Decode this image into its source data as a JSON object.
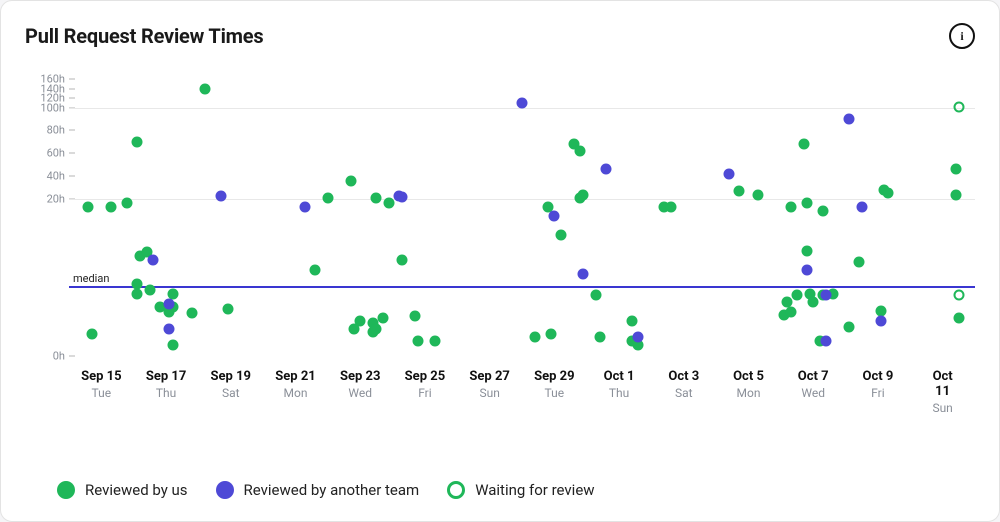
{
  "header": {
    "title": "Pull Request Review Times",
    "info_tooltip": "i"
  },
  "legend": {
    "items": [
      {
        "key": "us",
        "label": "Reviewed by us"
      },
      {
        "key": "other",
        "label": "Reviewed by another team"
      },
      {
        "key": "waiting",
        "label": "Waiting for review"
      }
    ]
  },
  "colors": {
    "us": "#1fb759",
    "other": "#4e49d6",
    "median": "#3a36d1"
  },
  "chart_data": {
    "type": "scatter",
    "title": "Pull Request Review Times",
    "xlabel": "",
    "ylabel": "",
    "y_scale": "log-linear-hybrid",
    "y_ticks": [
      0,
      20,
      40,
      60,
      80,
      100,
      120,
      140,
      160
    ],
    "y_tick_labels": [
      "0h",
      "20h",
      "40h",
      "60h",
      "80h",
      "100h",
      "120h",
      "140h",
      "160h"
    ],
    "y_gridlines": [
      20,
      100
    ],
    "x_ticks": [
      {
        "date": "Sep 15",
        "dow": "Tue"
      },
      {
        "date": "Sep 17",
        "dow": "Thu"
      },
      {
        "date": "Sep 19",
        "dow": "Sat"
      },
      {
        "date": "Sep 21",
        "dow": "Mon"
      },
      {
        "date": "Sep 23",
        "dow": "Wed"
      },
      {
        "date": "Sep 25",
        "dow": "Fri"
      },
      {
        "date": "Sep 27",
        "dow": "Sun"
      },
      {
        "date": "Sep 29",
        "dow": "Tue"
      },
      {
        "date": "Oct 1",
        "dow": "Thu"
      },
      {
        "date": "Oct 3",
        "dow": "Sat"
      },
      {
        "date": "Oct 5",
        "dow": "Mon"
      },
      {
        "date": "Oct 7",
        "dow": "Wed"
      },
      {
        "date": "Oct 9",
        "dow": "Fri"
      },
      {
        "date": "Oct 11",
        "dow": "Sun"
      }
    ],
    "x_domain_days": {
      "start": "Sep 14",
      "end": "Oct 12",
      "count": 29
    },
    "median_hours": 4,
    "median_label": "median",
    "series": [
      {
        "name": "Reviewed by us",
        "key": "us",
        "points": [
          {
            "day": 0.6,
            "hours": 18
          },
          {
            "day": 0.7,
            "hours": 0.4
          },
          {
            "day": 1.3,
            "hours": 18
          },
          {
            "day": 1.8,
            "hours": 19
          },
          {
            "day": 2.1,
            "hours": 70
          },
          {
            "day": 2.1,
            "hours": 4.2
          },
          {
            "day": 2.1,
            "hours": 3.2
          },
          {
            "day": 2.2,
            "hours": 8.2
          },
          {
            "day": 2.4,
            "hours": 8.8
          },
          {
            "day": 2.5,
            "hours": 3.6
          },
          {
            "day": 2.8,
            "hours": 2.0
          },
          {
            "day": 3.1,
            "hours": 1.6
          },
          {
            "day": 3.2,
            "hours": 0.1
          },
          {
            "day": 3.2,
            "hours": 3.2
          },
          {
            "day": 3.2,
            "hours": 2.0
          },
          {
            "day": 3.8,
            "hours": 1.5
          },
          {
            "day": 4.2,
            "hours": 140
          },
          {
            "day": 4.9,
            "hours": 1.8
          },
          {
            "day": 7.6,
            "hours": 6.0
          },
          {
            "day": 8.0,
            "hours": 21
          },
          {
            "day": 8.7,
            "hours": 36
          },
          {
            "day": 8.8,
            "hours": 0.6
          },
          {
            "day": 9.0,
            "hours": 1.0
          },
          {
            "day": 9.4,
            "hours": 0.5
          },
          {
            "day": 9.4,
            "hours": 0.9
          },
          {
            "day": 9.5,
            "hours": 21
          },
          {
            "day": 9.5,
            "hours": 0.6
          },
          {
            "day": 9.7,
            "hours": 1.2
          },
          {
            "day": 9.9,
            "hours": 19
          },
          {
            "day": 10.3,
            "hours": 7.5
          },
          {
            "day": 10.7,
            "hours": 1.3
          },
          {
            "day": 10.8,
            "hours": 0.2
          },
          {
            "day": 11.3,
            "hours": 0.2
          },
          {
            "day": 14.4,
            "hours": 0.3
          },
          {
            "day": 14.8,
            "hours": 18
          },
          {
            "day": 14.9,
            "hours": 0.4
          },
          {
            "day": 15.2,
            "hours": 12
          },
          {
            "day": 15.6,
            "hours": 68
          },
          {
            "day": 15.8,
            "hours": 21
          },
          {
            "day": 15.8,
            "hours": 62
          },
          {
            "day": 15.9,
            "hours": 24
          },
          {
            "day": 16.3,
            "hours": 3.0
          },
          {
            "day": 16.4,
            "hours": 0.3
          },
          {
            "day": 17.4,
            "hours": 1.0
          },
          {
            "day": 17.6,
            "hours": 0.1
          },
          {
            "day": 17.4,
            "hours": 0.2
          },
          {
            "day": 18.4,
            "hours": 18
          },
          {
            "day": 18.6,
            "hours": 18
          },
          {
            "day": 20.7,
            "hours": 27
          },
          {
            "day": 21.3,
            "hours": 24
          },
          {
            "day": 22.1,
            "hours": 1.4
          },
          {
            "day": 22.2,
            "hours": 2.4
          },
          {
            "day": 22.3,
            "hours": 1.6
          },
          {
            "day": 22.3,
            "hours": 18
          },
          {
            "day": 22.5,
            "hours": 3.0
          },
          {
            "day": 22.7,
            "hours": 68
          },
          {
            "day": 22.8,
            "hours": 9.0
          },
          {
            "day": 22.8,
            "hours": 19
          },
          {
            "day": 22.9,
            "hours": 3.2
          },
          {
            "day": 23.0,
            "hours": 2.4
          },
          {
            "day": 23.2,
            "hours": 0.2
          },
          {
            "day": 23.3,
            "hours": 17
          },
          {
            "day": 23.3,
            "hours": 3.0
          },
          {
            "day": 23.6,
            "hours": 3.1
          },
          {
            "day": 24.1,
            "hours": 0.7
          },
          {
            "day": 24.4,
            "hours": 7.2
          },
          {
            "day": 25.1,
            "hours": 1.7
          },
          {
            "day": 25.2,
            "hours": 28
          },
          {
            "day": 25.3,
            "hours": 25
          },
          {
            "day": 27.4,
            "hours": 46
          },
          {
            "day": 27.4,
            "hours": 24
          },
          {
            "day": 27.5,
            "hours": 1.2
          }
        ]
      },
      {
        "name": "Reviewed by another team",
        "key": "other",
        "points": [
          {
            "day": 2.6,
            "hours": 7.5
          },
          {
            "day": 3.1,
            "hours": 0.6
          },
          {
            "day": 3.1,
            "hours": 2.2
          },
          {
            "day": 4.7,
            "hours": 23
          },
          {
            "day": 7.3,
            "hours": 18
          },
          {
            "day": 10.2,
            "hours": 23
          },
          {
            "day": 10.3,
            "hours": 22
          },
          {
            "day": 14.0,
            "hours": 110
          },
          {
            "day": 15.0,
            "hours": 16
          },
          {
            "day": 15.9,
            "hours": 5.5
          },
          {
            "day": 16.6,
            "hours": 46
          },
          {
            "day": 17.6,
            "hours": 0.3
          },
          {
            "day": 20.4,
            "hours": 42
          },
          {
            "day": 22.8,
            "hours": 6.0
          },
          {
            "day": 23.4,
            "hours": 0.2
          },
          {
            "day": 23.4,
            "hours": 3.0
          },
          {
            "day": 24.1,
            "hours": 90
          },
          {
            "day": 24.5,
            "hours": 18
          },
          {
            "day": 25.1,
            "hours": 1.0
          }
        ]
      },
      {
        "name": "Waiting for review",
        "key": "waiting",
        "points": [
          {
            "day": 27.5,
            "hours": 102
          },
          {
            "day": 27.5,
            "hours": 3.0
          }
        ]
      }
    ]
  }
}
